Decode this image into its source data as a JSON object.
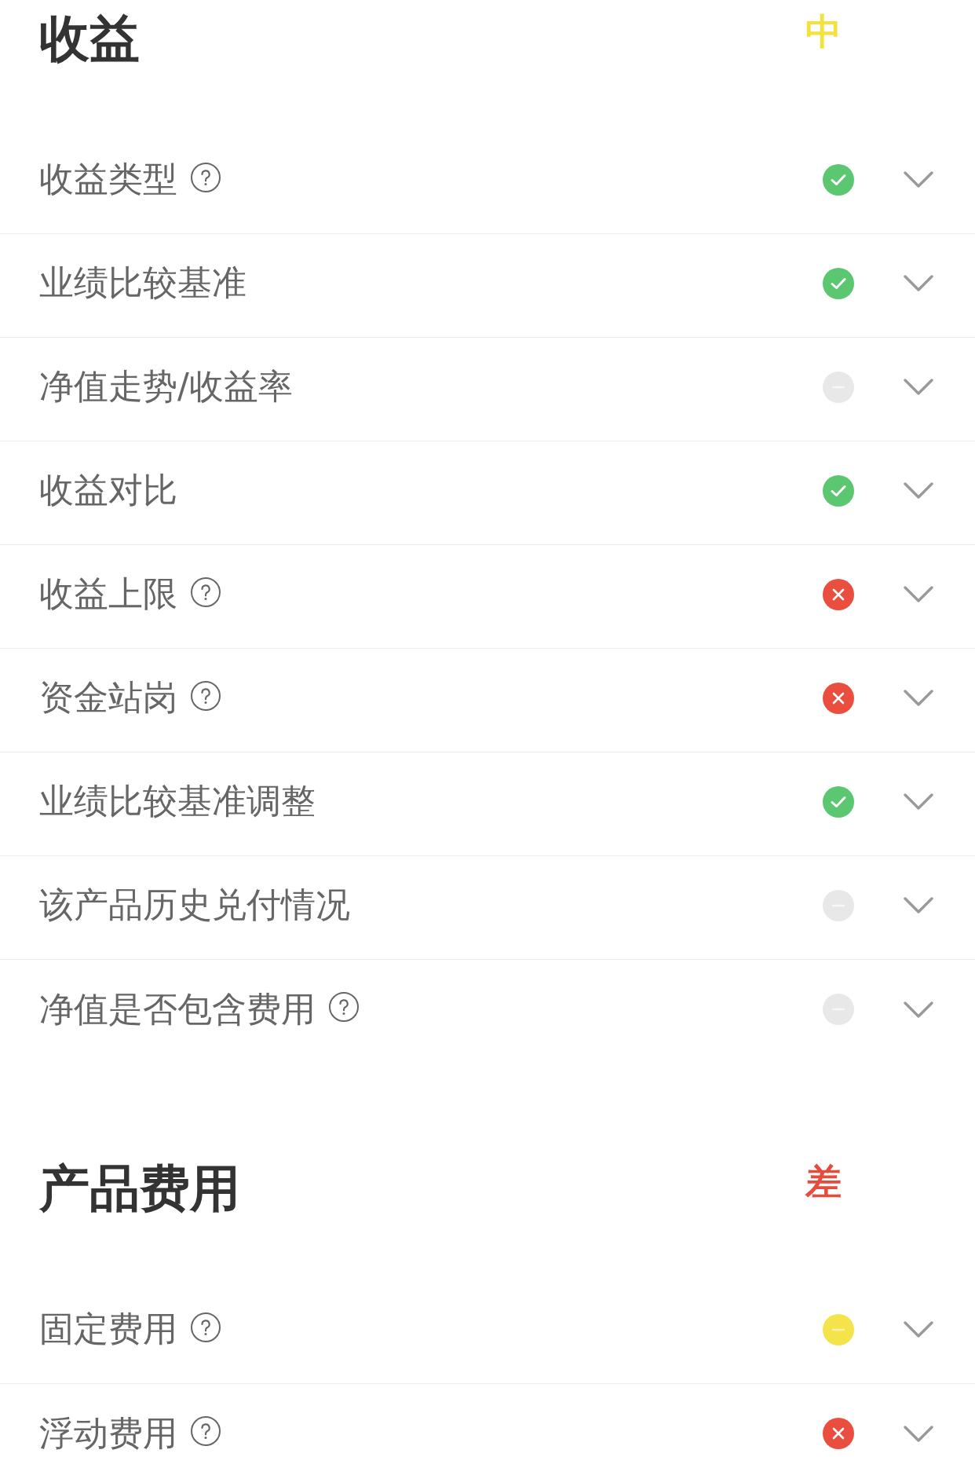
{
  "sections": [
    {
      "title": "收益",
      "rating": {
        "label": "中",
        "color": "#f4e23c"
      },
      "rows": [
        {
          "label": "收益类型",
          "help": true,
          "kind": "pass",
          "expanded": false
        },
        {
          "label": "业绩比较基准",
          "help": false,
          "kind": "pass",
          "expanded": false
        },
        {
          "label": "净值走势/收益率",
          "help": false,
          "kind": "na",
          "expanded": false
        },
        {
          "label": "收益对比",
          "help": false,
          "kind": "pass",
          "expanded": false
        },
        {
          "label": "收益上限",
          "help": true,
          "kind": "fail",
          "expanded": false
        },
        {
          "label": "资金站岗",
          "help": true,
          "kind": "fail",
          "expanded": false
        },
        {
          "label": "业绩比较基准调整",
          "help": false,
          "kind": "pass",
          "expanded": false
        },
        {
          "label": "该产品历史兑付情况",
          "help": false,
          "kind": "na",
          "expanded": false
        },
        {
          "label": "净值是否包含费用",
          "help": true,
          "kind": "na",
          "expanded": false
        }
      ]
    },
    {
      "title": "产品费用",
      "rating": {
        "label": "差",
        "color": "#e64c3c"
      },
      "rows": [
        {
          "label": "固定费用",
          "help": true,
          "kind": "warn",
          "expanded": false
        },
        {
          "label": "浮动费用",
          "help": true,
          "kind": "fail",
          "expanded": false
        }
      ]
    }
  ]
}
